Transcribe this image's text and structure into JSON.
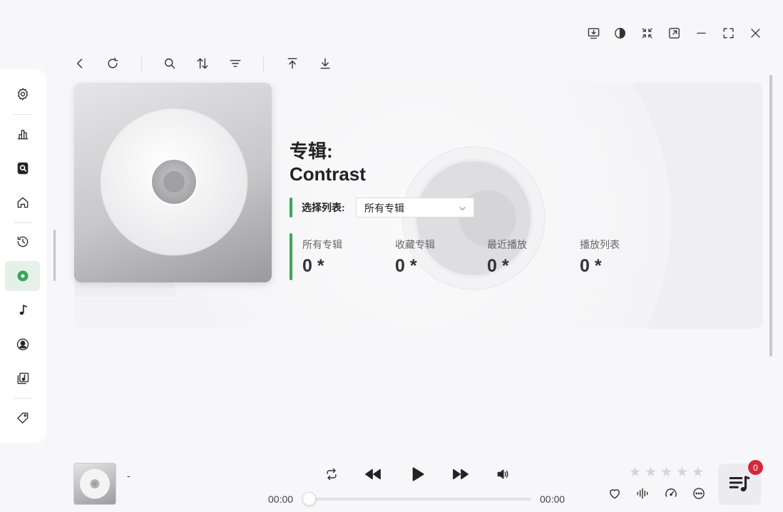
{
  "window_controls": [
    "download-to-device-icon",
    "contrast-icon",
    "collapse-arrows-icon",
    "popout-icon",
    "minimize-icon",
    "fullscreen-icon",
    "close-icon"
  ],
  "toolbar": [
    "back-icon",
    "refresh-icon",
    "search-icon",
    "sort-icon",
    "filter-icon",
    "scroll-to-top-icon",
    "scroll-to-bottom-icon"
  ],
  "sidebar": {
    "items": [
      "settings-icon",
      "stats-icon",
      "search-library-icon",
      "home-icon",
      "history-icon",
      "album-icon",
      "music-note-icon",
      "artist-icon",
      "playlist-icon",
      "tag-icon"
    ],
    "active": "album-icon"
  },
  "album": {
    "heading": "专辑:",
    "name": "Contrast",
    "select_label": "选择列表:",
    "select_value": "所有专辑",
    "stats": [
      {
        "label": "所有专辑",
        "value": "0 *"
      },
      {
        "label": "收藏专辑",
        "value": "0 *"
      },
      {
        "label": "最近播放",
        "value": "0 *"
      },
      {
        "label": "播放列表",
        "value": "0 *"
      }
    ]
  },
  "player": {
    "track_title": "-",
    "time_current": "00:00",
    "time_total": "00:00",
    "progress": 0,
    "rating": 0,
    "rating_max": 5,
    "queue_count": "0"
  },
  "colors": {
    "accent": "#3aa55a",
    "badge": "#d7263d"
  }
}
